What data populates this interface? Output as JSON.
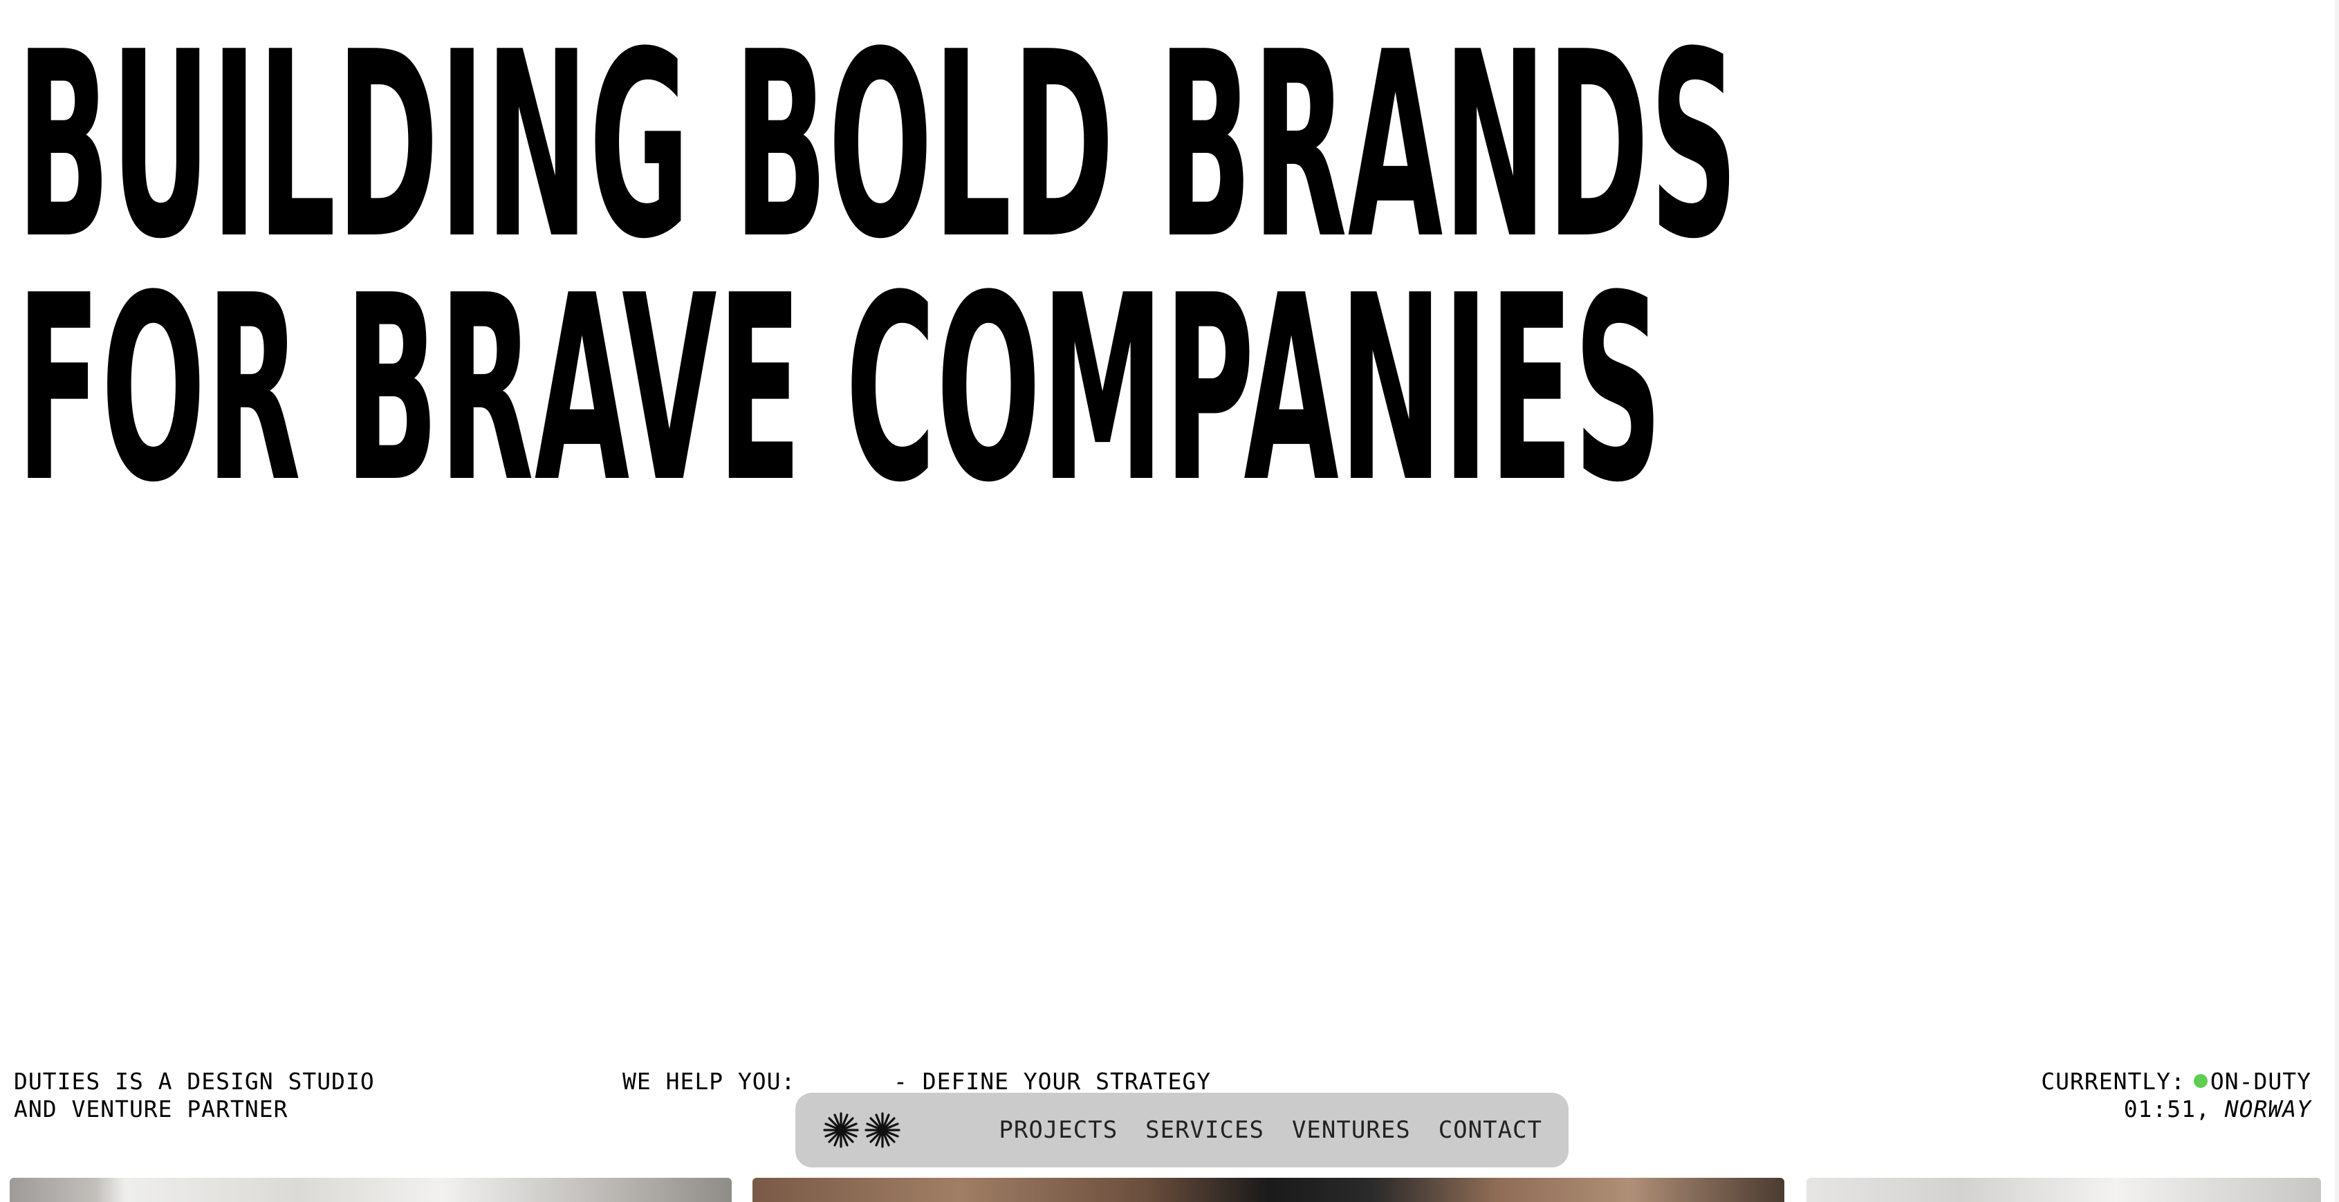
{
  "hero": {
    "line1": "BUILDING BOLD BRANDS",
    "line2": "FOR BRAVE COMPANIES"
  },
  "intro": {
    "line1": "DUTIES IS A DESIGN STUDIO",
    "line2": "AND VENTURE PARTNER"
  },
  "help": {
    "label": "WE HELP YOU:",
    "item": "- DEFINE YOUR STRATEGY"
  },
  "status": {
    "label": "CURRENTLY:",
    "value": "ON-DUTY",
    "time": "01:51,",
    "location": "NORWAY",
    "dot_color": "#5ccf50"
  },
  "nav": {
    "logo_icons": [
      "starburst-icon",
      "starburst-icon"
    ],
    "items": [
      "PROJECTS",
      "SERVICES",
      "VENTURES",
      "CONTACT"
    ]
  }
}
